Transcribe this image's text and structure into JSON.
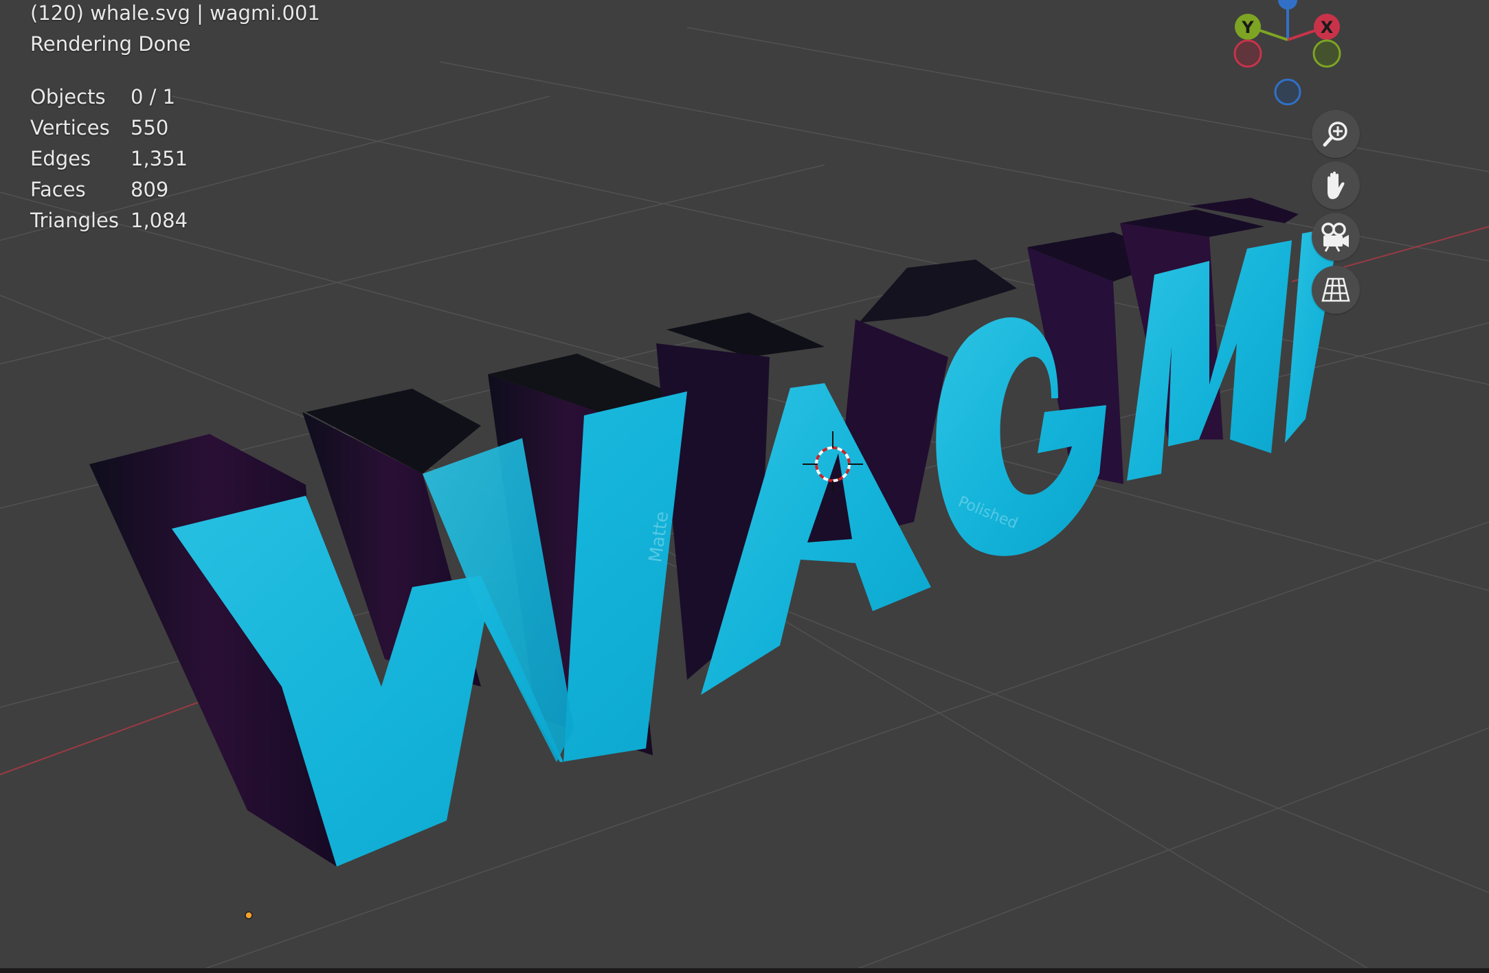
{
  "header": {
    "title": "(120) whale.svg | wagmi.001",
    "status": "Rendering Done"
  },
  "stats": [
    {
      "label": "Objects",
      "value": "0 / 1"
    },
    {
      "label": "Vertices",
      "value": "550"
    },
    {
      "label": "Edges",
      "value": "1,351"
    },
    {
      "label": "Faces",
      "value": "809"
    },
    {
      "label": "Triangles",
      "value": "1,084"
    }
  ],
  "gizmo": {
    "x_label": "X",
    "y_label": "Y",
    "x_color": "#c8334a",
    "y_color": "#7ea424",
    "z_color": "#3270c8"
  },
  "viewport_object": {
    "text": "WAGMI",
    "side_label_1": "Matte",
    "side_label_2": "Polished",
    "face_color": "#18b6da",
    "side_color": "#2a0f35"
  },
  "nav_buttons": [
    {
      "name": "zoom",
      "icon": "zoom-in-icon"
    },
    {
      "name": "pan",
      "icon": "hand-icon"
    },
    {
      "name": "camera",
      "icon": "camera-icon"
    },
    {
      "name": "perspective",
      "icon": "grid-perspective-icon"
    }
  ],
  "colors": {
    "viewport_bg": "#3f3f3f",
    "overlay_text": "#e9e9e9",
    "button_bg": "#4b4b4b"
  }
}
